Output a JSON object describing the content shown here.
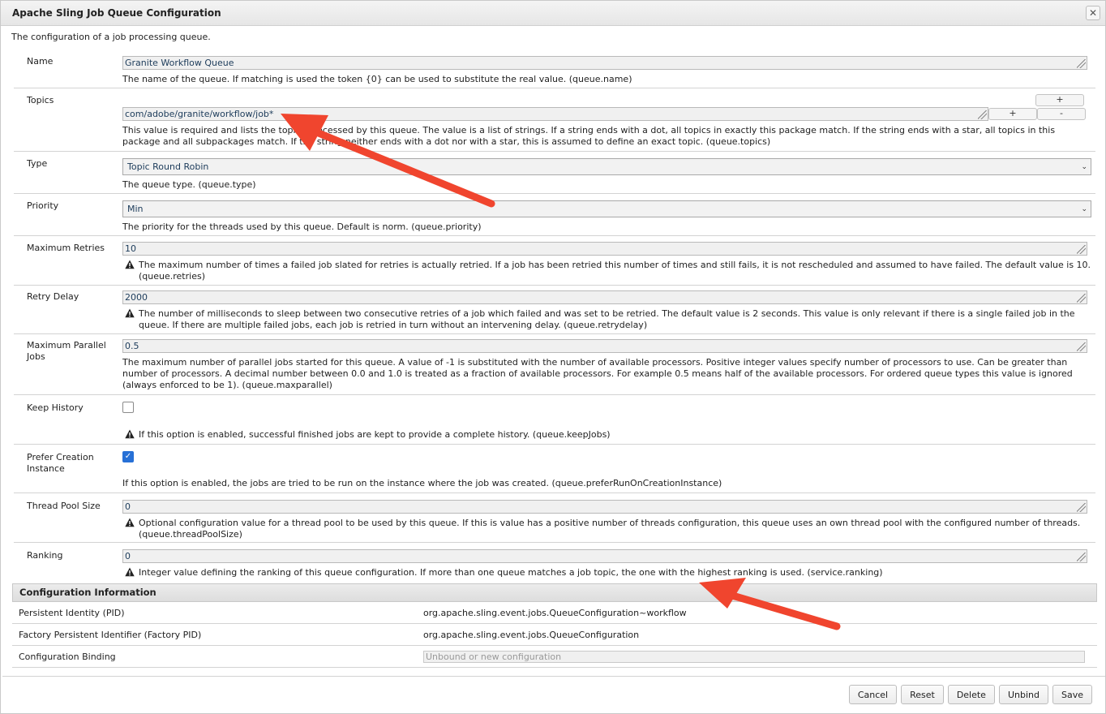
{
  "window": {
    "title": "Apache Sling Job Queue Configuration",
    "close_glyph": "✕"
  },
  "description": "The configuration of a job processing queue.",
  "fields": {
    "name": {
      "label": "Name",
      "value": "Granite Workflow Queue",
      "help": "The name of the queue. If matching is used the token {0} can be used to substitute the real value. (queue.name)"
    },
    "topics": {
      "label": "Topics",
      "value": "com/adobe/granite/workflow/job*",
      "add_label": "+",
      "remove_label": "-",
      "help": "This value is required and lists the topics processed by this queue. The value is a list of strings. If a string ends with a dot, all topics in exactly this package match. If the string ends with a star, all topics in this package and all subpackages match. If the string neither ends with a dot nor with a star, this is assumed to define an exact topic. (queue.topics)"
    },
    "type": {
      "label": "Type",
      "value": "Topic Round Robin",
      "help": "The queue type. (queue.type)"
    },
    "priority": {
      "label": "Priority",
      "value": "Min",
      "help": "The priority for the threads used by this queue. Default is norm. (queue.priority)"
    },
    "max_retries": {
      "label": "Maximum Retries",
      "value": "10",
      "help": "The maximum number of times a failed job slated for retries is actually retried. If a job has been retried this number of times and still fails, it is not rescheduled and assumed to have failed. The default value is 10. (queue.retries)"
    },
    "retry_delay": {
      "label": "Retry Delay",
      "value": "2000",
      "help": "The number of milliseconds to sleep between two consecutive retries of a job which failed and was set to be retried. The default value is 2 seconds. This value is only relevant if there is a single failed job in the queue. If there are multiple failed jobs, each job is retried in turn without an intervening delay. (queue.retrydelay)"
    },
    "max_parallel": {
      "label": "Maximum Parallel Jobs",
      "value": "0.5",
      "help": "The maximum number of parallel jobs started for this queue. A value of -1 is substituted with the number of available processors. Positive integer values specify number of processors to use.  Can be greater than number of processors. A decimal number between 0.0 and 1.0 is treated as a fraction of available processors. For example 0.5 means half of the available processors. For ordered queue types this value is ignored (always enforced to be 1). (queue.maxparallel)"
    },
    "keep_history": {
      "label": "Keep History",
      "checked": false,
      "help": "If this option is enabled, successful finished jobs are kept to provide a complete history. (queue.keepJobs)"
    },
    "prefer_creation": {
      "label": "Prefer Creation Instance",
      "checked": true,
      "check_glyph": "✓",
      "help": "If this option is enabled, the jobs are tried to be run on the instance where the job was created. (queue.preferRunOnCreationInstance)"
    },
    "thread_pool": {
      "label": "Thread Pool Size",
      "value": "0",
      "help": "Optional configuration value for a thread pool to be used by this queue. If this is value has a positive number of threads configuration, this queue uses an own thread pool with the configured number of threads. (queue.threadPoolSize)"
    },
    "ranking": {
      "label": "Ranking",
      "value": "0",
      "help": "Integer value defining the ranking of this queue configuration. If more than one queue matches a job topic, the one with the highest ranking is used. (service.ranking)"
    }
  },
  "config_info": {
    "header": "Configuration Information",
    "pid_label": "Persistent Identity (PID)",
    "pid_value": "org.apache.sling.event.jobs.QueueConfiguration~workflow",
    "factory_label": "Factory Persistent Identifier (Factory PID)",
    "factory_value": "org.apache.sling.event.jobs.QueueConfiguration",
    "binding_label": "Configuration Binding",
    "binding_placeholder": "Unbound or new configuration"
  },
  "buttons": {
    "cancel": "Cancel",
    "reset": "Reset",
    "delete": "Delete",
    "unbind": "Unbind",
    "save": "Save"
  },
  "colors": {
    "annotation_arrow": "#f0452e",
    "checkbox_checked": "#2770d6"
  }
}
